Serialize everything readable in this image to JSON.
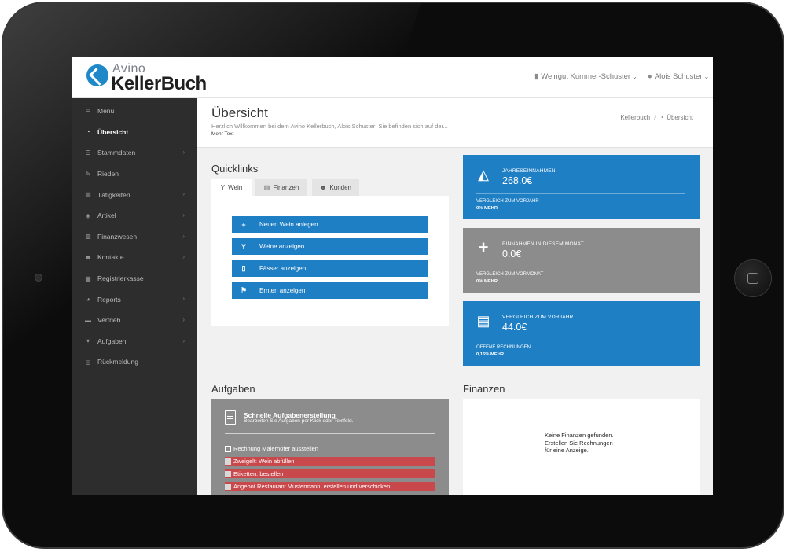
{
  "brand": {
    "small": "Avino",
    "big_part1": "Keller",
    "big_part2": "Buch"
  },
  "topbar": {
    "company": "Weingut Kummer-Schuster",
    "user": "Alois Schuster",
    "company_icon": "building-icon",
    "user_icon": "user-icon"
  },
  "sidebar": {
    "items": [
      {
        "label": "Menü",
        "icon": "bars-icon",
        "chevron": false
      },
      {
        "label": "Übersicht",
        "icon": "dashboard-icon",
        "chevron": false,
        "active": true
      },
      {
        "label": "Stammdaten",
        "icon": "sliders-icon",
        "chevron": true
      },
      {
        "label": "Rieden",
        "icon": "leaf-icon",
        "chevron": false
      },
      {
        "label": "Tätigkeiten",
        "icon": "book-icon",
        "chevron": true
      },
      {
        "label": "Artikel",
        "icon": "cube-icon",
        "chevron": true
      },
      {
        "label": "Finanzwesen",
        "icon": "chart-icon",
        "chevron": true
      },
      {
        "label": "Kontakte",
        "icon": "users-icon",
        "chevron": true
      },
      {
        "label": "Registrierkasse",
        "icon": "register-icon",
        "chevron": false
      },
      {
        "label": "Reports",
        "icon": "pie-icon",
        "chevron": true
      },
      {
        "label": "Vertrieb",
        "icon": "truck-icon",
        "chevron": true
      },
      {
        "label": "Aufgaben",
        "icon": "basket-icon",
        "chevron": true
      },
      {
        "label": "Rückmeldung",
        "icon": "lifebuoy-icon",
        "chevron": false
      }
    ]
  },
  "header": {
    "title": "Übersicht",
    "subtitle": "Herzlich Willkommen bei dem Avino Kellerbuch, Alois Schuster! Sie befinden sich auf der...",
    "more": "Mehr Text",
    "breadcrumb": [
      "Kellerbuch",
      "Übersicht"
    ]
  },
  "quicklinks": {
    "title": "Quicklinks",
    "tabs": [
      {
        "label": "Wein",
        "icon": "glass-icon"
      },
      {
        "label": "Finanzen",
        "icon": "bar-chart-icon"
      },
      {
        "label": "Kunden",
        "icon": "users-icon"
      }
    ],
    "buttons": [
      {
        "label": "Neuen Wein anlegen",
        "icon": "plus-icon"
      },
      {
        "label": "Weine anzeigen",
        "icon": "glass-icon"
      },
      {
        "label": "Fässer anzeigen",
        "icon": "barrel-icon"
      },
      {
        "label": "Ernten anzeigen",
        "icon": "flag-icon"
      }
    ]
  },
  "stats": [
    {
      "label": "JAHRESEINNAHMEN",
      "value": "268.0€",
      "compare": "VERGLEICH ZUM VORJAHR",
      "pct": "0% MEHR",
      "icon": "area-chart-icon",
      "color": "#1f7fc4"
    },
    {
      "label": "EINNAHMEN IN DIESEM MONAT",
      "value": "0.0€",
      "compare": "VERGLEICH ZUM VORMONAT",
      "pct": "0% MEHR",
      "icon": "plus-icon",
      "color": "#8c8c8c"
    },
    {
      "label": "VERGLEICH ZUM VORJAHR",
      "value": "44.0€",
      "compare": "OFFENE RECHNUNGEN",
      "pct": "0,16% MEHR",
      "icon": "archive-icon",
      "color": "#1f7fc4"
    }
  ],
  "tasks": {
    "title": "Aufgaben",
    "panel_title": "Schnelle Aufgabenerstellung",
    "panel_sub": "Bearbeiten Sie Aufgaben per Klick oder Textfeld.",
    "items": [
      {
        "label": "Rechnung Maierhofer ausstellen",
        "urgent": false
      },
      {
        "label": "Zweigelt: Wein abfüllen",
        "urgent": true
      },
      {
        "label": "Etiketten: bestellen",
        "urgent": true
      },
      {
        "label": "Angebot Restaurant Mustermann: erstellen und verschicken",
        "urgent": true
      }
    ]
  },
  "finances": {
    "title": "Finanzen",
    "empty_line1": "Keine Finanzen gefunden.",
    "empty_line2": "Erstellen Sie Rechnungen",
    "empty_line3": "für eine Anzeige."
  }
}
